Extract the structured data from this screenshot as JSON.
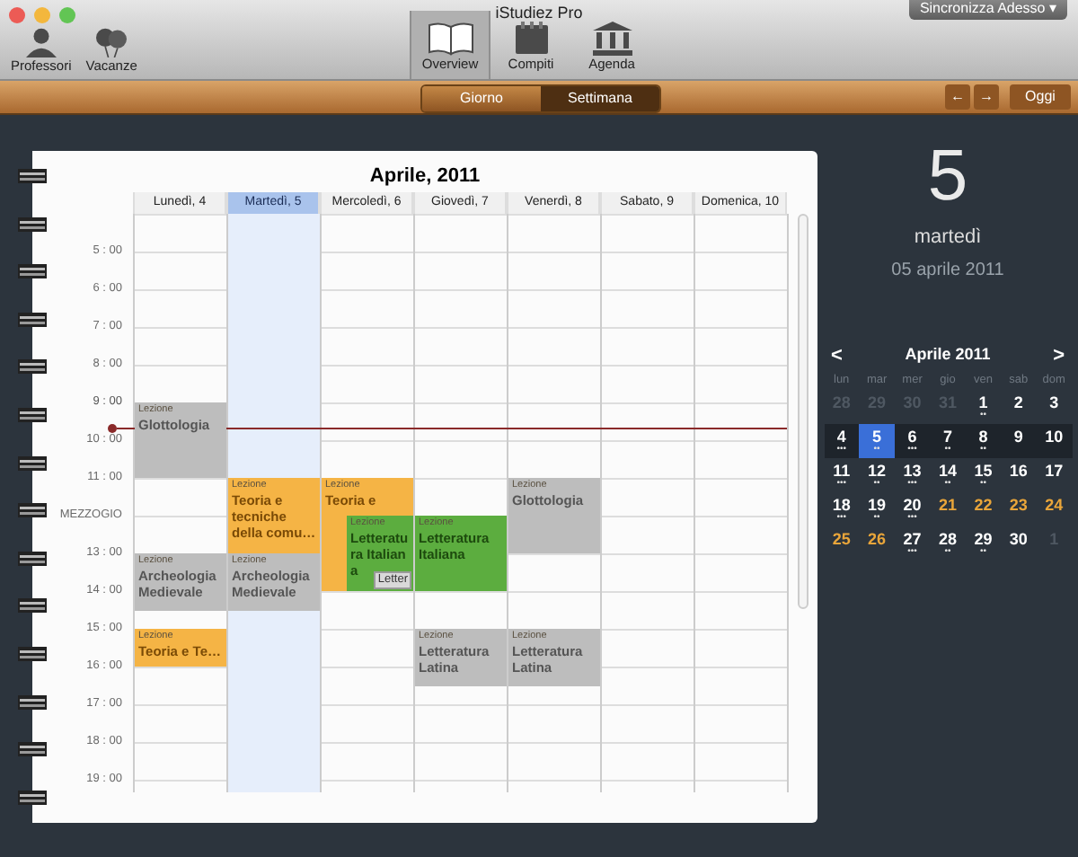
{
  "window": {
    "title": "iStudiez Pro"
  },
  "toolbar": {
    "left": [
      {
        "label": "Professori",
        "kind": "person"
      },
      {
        "label": "Vacanze",
        "kind": "balloons"
      }
    ],
    "center": [
      {
        "label": "Overview",
        "kind": "book",
        "selected": true
      },
      {
        "label": "Compiti",
        "kind": "notepad",
        "selected": false
      },
      {
        "label": "Agenda",
        "kind": "building",
        "selected": false
      }
    ],
    "sync_button": "Sincronizza Adesso",
    "sync_caret": "▾"
  },
  "view_switch": [
    {
      "label": "Giorno",
      "selected": false
    },
    {
      "label": "Settimana",
      "selected": true
    }
  ],
  "nav": {
    "prev": "←",
    "next": "→",
    "today": "Oggi"
  },
  "week": {
    "title": "Aprile, 2011",
    "hours": [
      {
        "label": "5 : 00",
        "current_time": false
      },
      {
        "label": "6 : 00",
        "current_time": false
      },
      {
        "label": "7 : 00",
        "current_time": false
      },
      {
        "label": "8 : 00",
        "current_time": false
      },
      {
        "label": "9 : 00",
        "current_time": true
      },
      {
        "label": "10 : 00",
        "current_time": false
      },
      {
        "label": "11 : 00",
        "current_time": false
      },
      {
        "label": "MEZZOGIO",
        "current_time": false
      },
      {
        "label": "13 : 00",
        "current_time": false
      },
      {
        "label": "14 : 00",
        "current_time": false
      },
      {
        "label": "15 : 00",
        "current_time": false
      },
      {
        "label": "16 : 00",
        "current_time": false
      },
      {
        "label": "17 : 00",
        "current_time": false
      },
      {
        "label": "18 : 00",
        "current_time": false
      },
      {
        "label": "19 : 00",
        "current_time": false
      }
    ],
    "days": [
      {
        "label": "Lunedì, 4",
        "selected": false,
        "items": [
          {
            "kind": "gap"
          },
          {
            "kind": "gap"
          },
          {
            "kind": "gap"
          },
          {
            "kind": "gap"
          },
          {
            "kind": "gap"
          },
          {
            "kind": "lesson_2h",
            "type": "Lezione",
            "title": "Glottologia",
            "color": "#bdbdbd"
          },
          {
            "kind": "gap"
          },
          {
            "kind": "gap"
          },
          {
            "kind": "lesson_1_5h",
            "type": "Lezione",
            "title": "Archeologia Medievale",
            "color": "#bdbdbd"
          },
          {
            "kind": "gap_half"
          },
          {
            "kind": "lesson_1h",
            "type": "Lezione",
            "title": "Teoria e Te…",
            "color": "#f5b445"
          }
        ]
      },
      {
        "label": "Martedì, 5",
        "selected": true,
        "items": [
          {
            "kind": "gap"
          },
          {
            "kind": "gap"
          },
          {
            "kind": "gap"
          },
          {
            "kind": "gap"
          },
          {
            "kind": "gap"
          },
          {
            "kind": "gap"
          },
          {
            "kind": "gap"
          },
          {
            "kind": "lesson_2h",
            "type": "Lezione",
            "title": "Teoria e tecniche della comu…",
            "color": "#f5b445"
          },
          {
            "kind": "lesson_1_5h",
            "type": "Lezione",
            "title": "Archeologia Medievale",
            "color": "#bdbdbd"
          }
        ]
      },
      {
        "label": "Mercoledì, 6",
        "selected": false,
        "items": [
          {
            "kind": "gap"
          },
          {
            "kind": "gap"
          },
          {
            "kind": "gap"
          },
          {
            "kind": "gap"
          },
          {
            "kind": "gap"
          },
          {
            "kind": "gap"
          },
          {
            "kind": "gap"
          },
          {
            "kind": "lesson_3h",
            "type": "Lezione",
            "title": "Teoria e",
            "color": "#f5b445",
            "overlay": {
              "type": "Lezione",
              "title": "Letteratura Italiana",
              "color": "#5cad3f",
              "tooltip": "Letter"
            }
          }
        ]
      },
      {
        "label": "Giovedì, 7",
        "selected": false,
        "items": [
          {
            "kind": "gap"
          },
          {
            "kind": "gap"
          },
          {
            "kind": "gap"
          },
          {
            "kind": "gap"
          },
          {
            "kind": "gap"
          },
          {
            "kind": "gap"
          },
          {
            "kind": "gap"
          },
          {
            "kind": "gap"
          },
          {
            "kind": "lesson_2h",
            "type": "Lezione",
            "title": "Letteratura Italiana",
            "color": "#5cad3f"
          },
          {
            "kind": "gap"
          },
          {
            "kind": "lesson_1_5h",
            "type": "Lezione",
            "title": "Letteratura Latina",
            "color": "#bdbdbd"
          }
        ]
      },
      {
        "label": "Venerdì, 8",
        "selected": false,
        "items": [
          {
            "kind": "gap"
          },
          {
            "kind": "gap"
          },
          {
            "kind": "gap"
          },
          {
            "kind": "gap"
          },
          {
            "kind": "gap"
          },
          {
            "kind": "gap"
          },
          {
            "kind": "gap"
          },
          {
            "kind": "lesson_2h",
            "type": "Lezione",
            "title": "Glottologia",
            "color": "#bdbdbd"
          },
          {
            "kind": "gap"
          },
          {
            "kind": "gap"
          },
          {
            "kind": "lesson_1_5h",
            "type": "Lezione",
            "title": "Letteratura Latina",
            "color": "#bdbdbd"
          }
        ]
      },
      {
        "label": "Sabato, 9",
        "selected": false
      },
      {
        "label": "Domenica, 10",
        "selected": false
      }
    ]
  },
  "today": {
    "day_number": "5",
    "weekday": "martedì",
    "date": "05 aprile 2011"
  },
  "mini_calendar": {
    "prev": "<",
    "title": "Aprile 2011",
    "next": ">",
    "weekdays": [
      "lun",
      "mar",
      "mer",
      "gio",
      "ven",
      "sab",
      "dom"
    ],
    "weeks": [
      {
        "current": false,
        "days": [
          {
            "label": "28",
            "kind": "other",
            "selected": false
          },
          {
            "label": "29",
            "kind": "other",
            "selected": false
          },
          {
            "label": "30",
            "kind": "other",
            "selected": false
          },
          {
            "label": "31",
            "kind": "other",
            "selected": false
          },
          {
            "label": "1",
            "kind": "day",
            "dots": "••",
            "selected": false
          },
          {
            "label": "2",
            "kind": "day",
            "selected": false
          },
          {
            "label": "3",
            "kind": "day",
            "selected": false
          }
        ]
      },
      {
        "current": true,
        "days": [
          {
            "label": "4",
            "kind": "day",
            "dots": "•••",
            "selected": false
          },
          {
            "label": "5",
            "kind": "day",
            "dots": "••",
            "selected": true
          },
          {
            "label": "6",
            "kind": "day",
            "dots": "•••",
            "selected": false
          },
          {
            "label": "7",
            "kind": "day",
            "dots": "••",
            "selected": false
          },
          {
            "label": "8",
            "kind": "day",
            "dots": "••",
            "selected": false
          },
          {
            "label": "9",
            "kind": "day",
            "selected": false
          },
          {
            "label": "10",
            "kind": "day",
            "selected": false
          }
        ]
      },
      {
        "current": false,
        "days": [
          {
            "label": "11",
            "kind": "day",
            "dots": "•••",
            "selected": false
          },
          {
            "label": "12",
            "kind": "day",
            "dots": "••",
            "selected": false
          },
          {
            "label": "13",
            "kind": "day",
            "dots": "•••",
            "selected": false
          },
          {
            "label": "14",
            "kind": "day",
            "dots": "••",
            "selected": false
          },
          {
            "label": "15",
            "kind": "day",
            "dots": "••",
            "selected": false
          },
          {
            "label": "16",
            "kind": "day",
            "selected": false
          },
          {
            "label": "17",
            "kind": "day",
            "selected": false
          }
        ]
      },
      {
        "current": false,
        "days": [
          {
            "label": "18",
            "kind": "day",
            "dots": "•••",
            "selected": false
          },
          {
            "label": "19",
            "kind": "day",
            "dots": "••",
            "selected": false
          },
          {
            "label": "20",
            "kind": "day",
            "dots": "•••",
            "selected": false
          },
          {
            "label": "21",
            "kind": "holiday",
            "selected": false
          },
          {
            "label": "22",
            "kind": "holiday",
            "selected": false
          },
          {
            "label": "23",
            "kind": "holiday",
            "selected": false
          },
          {
            "label": "24",
            "kind": "holiday",
            "selected": false
          }
        ]
      },
      {
        "current": false,
        "days": [
          {
            "label": "25",
            "kind": "holiday",
            "selected": false
          },
          {
            "label": "26",
            "kind": "holiday",
            "selected": false
          },
          {
            "label": "27",
            "kind": "day",
            "dots": "•••",
            "selected": false
          },
          {
            "label": "28",
            "kind": "day",
            "dots": "••",
            "selected": false
          },
          {
            "label": "29",
            "kind": "day",
            "dots": "••",
            "selected": false
          },
          {
            "label": "30",
            "kind": "day",
            "selected": false
          },
          {
            "label": "1",
            "kind": "other",
            "selected": false
          }
        ]
      }
    ]
  }
}
